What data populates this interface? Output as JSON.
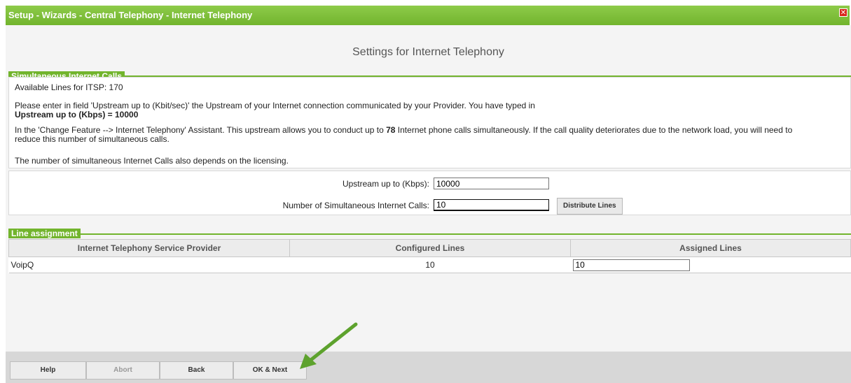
{
  "window": {
    "title": "Setup - Wizards - Central Telephony - Internet Telephony",
    "close_icon": "close-icon"
  },
  "page": {
    "heading": "Settings for Internet Telephony"
  },
  "simultaneous": {
    "section_label": "Simultaneous Internet Calls",
    "available_lines": "Available Lines for ITSP: 170",
    "para1_line1": "Please enter in field 'Upstream up to (Kbit/sec)' the Upstream of your Internet connection communicated by your Provider. You have typed in",
    "para1_line2": "Upstream up to (Kbps) = 10000",
    "para2_before": "In the 'Change Feature --> Internet Telephony' Assistant. This upstream allows you to conduct up to ",
    "para2_bold": "78",
    "para2_after": " Internet phone calls simultaneously. If the call quality deteriorates due to the network load, you will need to",
    "para2_line2": "reduce this number of simultaneous calls.",
    "para3": "The number of simultaneous Internet Calls also depends on the licensing.",
    "upstream_label": "Upstream up to (Kbps):",
    "upstream_value": "10000",
    "calls_label": "Number of Simultaneous Internet Calls:",
    "calls_value": "10",
    "distribute_button": "Distribute Lines"
  },
  "line_assignment": {
    "section_label": "Line assignment",
    "columns": [
      "Internet Telephony Service Provider",
      "Configured Lines",
      "Assigned Lines"
    ],
    "rows": [
      {
        "provider": "VoipQ",
        "configured": "10",
        "assigned": "10"
      }
    ]
  },
  "footer": {
    "help": "Help",
    "abort": "Abort",
    "back": "Back",
    "ok_next": "OK & Next"
  },
  "colors": {
    "accent": "#72b42d",
    "close": "#d9261c",
    "arrow": "#5da22d"
  }
}
